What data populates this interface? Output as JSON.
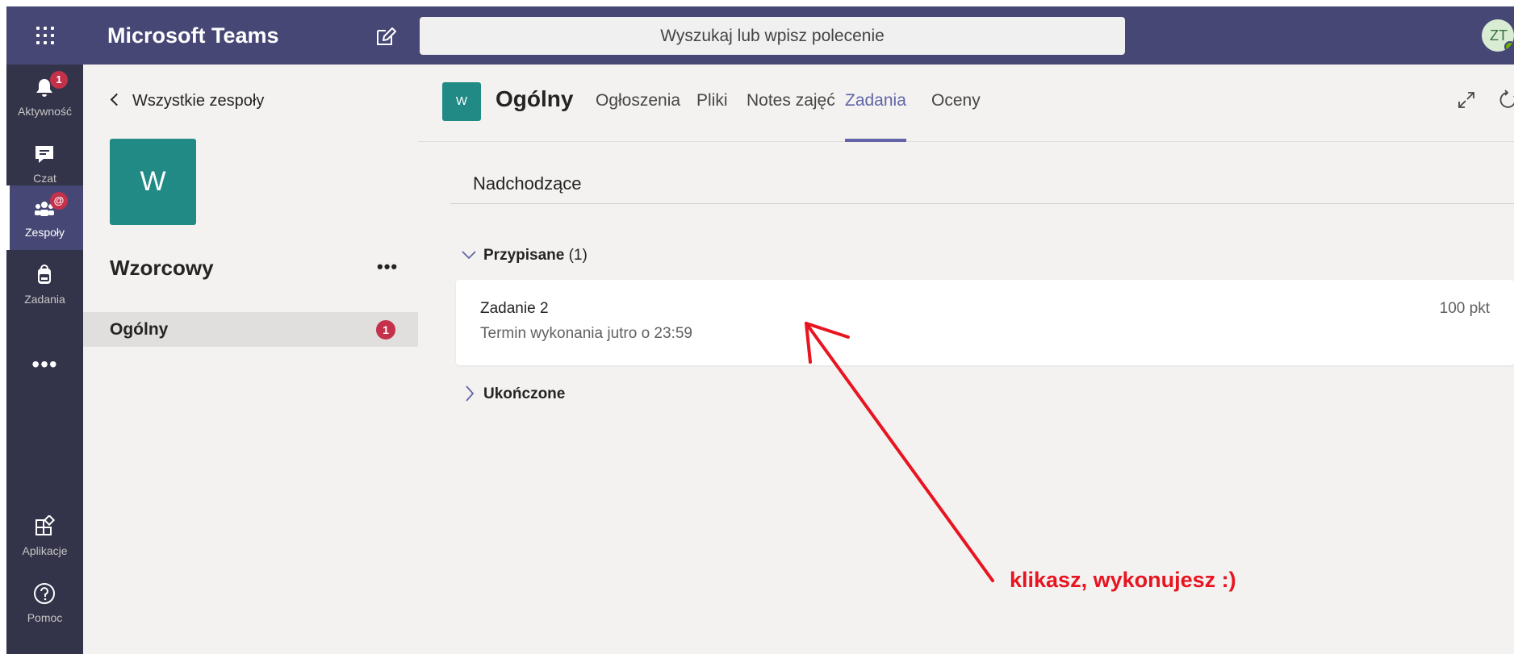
{
  "topbar": {
    "app_title": "Microsoft Teams",
    "search_placeholder": "Wyszukaj lub wpisz polecenie",
    "avatar_initials": "ZT"
  },
  "rail": {
    "items": [
      {
        "label": "Aktywność",
        "icon": "bell-icon",
        "badge": "1"
      },
      {
        "label": "Czat",
        "icon": "chat-icon"
      },
      {
        "label": "Zespoły",
        "icon": "teams-icon",
        "badge": "@"
      },
      {
        "label": "Zadania",
        "icon": "backpack-icon"
      }
    ],
    "more": "•••",
    "bottom_items": [
      {
        "label": "Aplikacje",
        "icon": "apps-icon"
      },
      {
        "label": "Pomoc",
        "icon": "help-icon"
      }
    ]
  },
  "team_panel": {
    "back_label": "Wszystkie zespoły",
    "team_initial": "W",
    "team_name": "Wzorcowy",
    "more": "•••",
    "channel": {
      "name": "Ogólny",
      "badge": "1"
    }
  },
  "main": {
    "channel_initial": "W",
    "channel_title": "Ogólny",
    "tabs": [
      "Ogłoszenia",
      "Pliki",
      "Notes zajęć",
      "Zadania",
      "Oceny"
    ],
    "active_tab": "Zadania",
    "upcoming_label": "Nadchodzące",
    "assigned": {
      "label": "Przypisane",
      "count": "(1)"
    },
    "assignment": {
      "title": "Zadanie 2",
      "due": "Termin wykonania jutro o 23:59",
      "points": "100 pkt"
    },
    "completed_label": "Ukończone"
  },
  "annotation": {
    "text": "klikasz, wykonujesz :)",
    "color": "#e8141f"
  },
  "colors": {
    "topbar": "#464775",
    "rail": "#33344a",
    "accent": "#6264a7",
    "team_tile": "#218a85",
    "badge": "#c4314b"
  }
}
